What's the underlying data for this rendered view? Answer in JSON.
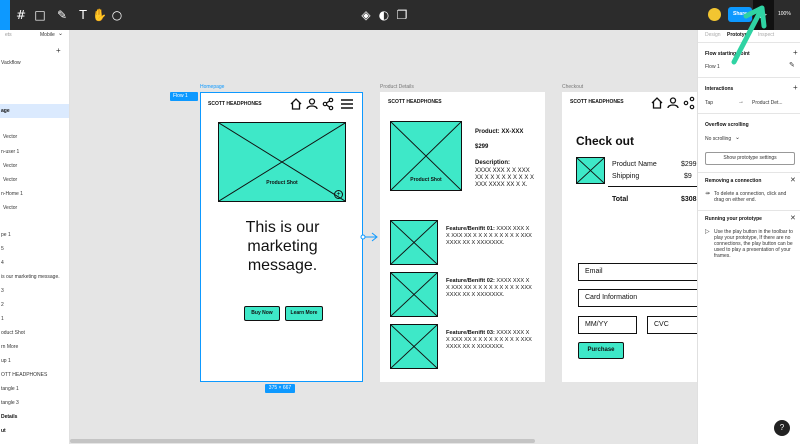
{
  "toolbar": {
    "share_label": "Share",
    "zoom_label": "100%",
    "accent": "#0d99ff"
  },
  "left_panel": {
    "tabs": [
      "ets",
      "Mobile"
    ],
    "rows": [
      {
        "label": "Vackflow",
        "sel": false,
        "bold": false
      },
      {
        "label": "age",
        "sel": true,
        "bold": true
      },
      {
        "label": "Vector",
        "sel": false,
        "bold": false
      },
      {
        "label": "n-user 1",
        "sel": false,
        "bold": false
      },
      {
        "label": "Vector",
        "sel": false,
        "bold": false
      },
      {
        "label": "Vector",
        "sel": false,
        "bold": false
      },
      {
        "label": "n-Home 1",
        "sel": false,
        "bold": false
      },
      {
        "label": "Vector",
        "sel": false,
        "bold": false
      },
      {
        "label": "pe 1",
        "sel": false,
        "bold": false
      },
      {
        "label": "5",
        "sel": false,
        "bold": false
      },
      {
        "label": "4",
        "sel": false,
        "bold": false
      },
      {
        "label": "is our marketing message.",
        "sel": false,
        "bold": false
      },
      {
        "label": "3",
        "sel": false,
        "bold": false
      },
      {
        "label": "2",
        "sel": false,
        "bold": false
      },
      {
        "label": "1",
        "sel": false,
        "bold": false
      },
      {
        "label": "oduct Shot",
        "sel": false,
        "bold": false
      },
      {
        "label": "rn More",
        "sel": false,
        "bold": false
      },
      {
        "label": "up 1",
        "sel": false,
        "bold": false
      },
      {
        "label": "OTT HEADPHONES",
        "sel": false,
        "bold": false
      },
      {
        "label": "tangle 1",
        "sel": false,
        "bold": false
      },
      {
        "label": "tangle 3",
        "sel": false,
        "bold": false
      },
      {
        "label": "Details",
        "sel": false,
        "bold": true
      },
      {
        "label": "ut",
        "sel": false,
        "bold": true
      }
    ]
  },
  "canvas": {
    "flow_badge": "Flow 1",
    "size_badge": "375 × 667",
    "homepage": {
      "label": "Homepage",
      "brand": "SCOTT HEADPHONES",
      "product_shot": "Product Shot",
      "message": "This is our marketing message.",
      "buy_now": "Buy Now",
      "learn_more": "Learn More"
    },
    "product_details": {
      "label": "Product Details",
      "brand": "SCOTT HEADPHONES",
      "product_shot": "Product Shot",
      "product": "Product: XX-XXX",
      "price": "$299",
      "description_title": "Description:",
      "description_body": "XXXX XXX X X XXX XX X X X X X X X X X XXX XXXX XX X X.",
      "features": [
        {
          "title": "Feature/Benifit 01:",
          "body": "XXXX XXX X X XXX XX X X X X X X X X X XXX XXXX XX X XXXXXXX."
        },
        {
          "title": "Feature/Benifit 02:",
          "body": "XXXX XXX X X XXX XX X X X X X X X X X XXX XXXX XX X XXXXXXX."
        },
        {
          "title": "Feature/Benifit 03:",
          "body": "XXXX XXX X X XXX XX X X X X X X X X X XXX XXXX XX X XXXXXXX."
        }
      ]
    },
    "checkout": {
      "label": "Checkout",
      "brand": "SCOTT HEADPHONES",
      "title": "Check out",
      "product_name": "Product Name",
      "product_price": "$299",
      "shipping": "Shipping",
      "shipping_price": "$9",
      "total": "Total",
      "total_price": "$308",
      "email": "Email",
      "card": "Card Information",
      "mmyy": "MM/YY",
      "cvc": "CVC",
      "purchase": "Purchase"
    }
  },
  "right_panel": {
    "tabs": [
      "Design",
      "Prototype",
      "Inspect"
    ],
    "flow_heading": "Flow starting point",
    "flow_item": "Flow 1",
    "interactions_heading": "Interactions",
    "tap": "Tap",
    "tap_target": "Product Det...",
    "overflow_heading": "Overflow scrolling",
    "overflow_value": "No scrolling",
    "show_settings": "Show prototype settings",
    "remove_heading": "Removing a connection",
    "remove_body": "To delete a connection, click and drag on either end.",
    "running_heading": "Running your prototype",
    "running_body": "Use the play button in the toolbar to play your prototype, If there are no connections, the play button can be used to play a presentation of your frames.",
    "help": "?"
  }
}
